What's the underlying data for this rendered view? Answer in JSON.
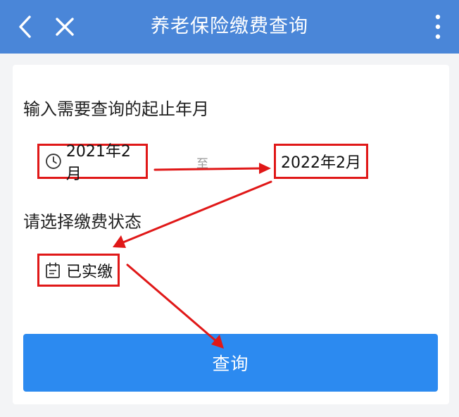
{
  "header": {
    "title": "养老保险缴费查询",
    "back_icon": "chevron-left-icon",
    "close_icon": "close-icon",
    "more_icon": "more-vertical-icon"
  },
  "form": {
    "date_label": "输入需要查询的起止年月",
    "start_date": "2021年2月",
    "separator": "至",
    "end_date": "2022年2月",
    "status_label": "请选择缴费状态",
    "status_value": "已实缴",
    "submit_label": "查询"
  },
  "colors": {
    "header_bg": "#4a86d8",
    "button_bg": "#2c8af0",
    "annotation_red": "#e01818"
  }
}
